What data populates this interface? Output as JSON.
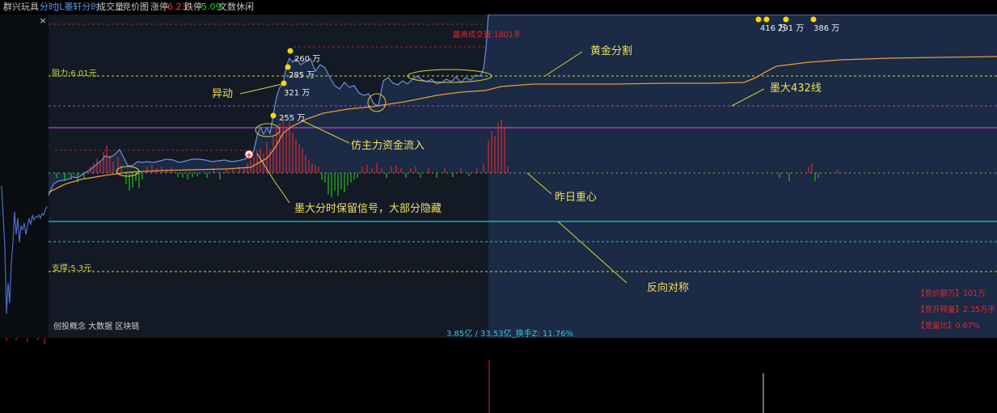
{
  "header": {
    "stock_name": "群兴玩具",
    "tab_intraday": "分时",
    "tab_custom": "JL墨轩分时",
    "btn_volume": "成交量",
    "btn_auction": "竞价图",
    "limit_up_label": "涨停",
    "limit_up_value": "6.23",
    "limit_down_label": "跌停",
    "limit_down_value": "5.09",
    "font_label": "文数休闲"
  },
  "close_glyph": "×",
  "levels": {
    "resistance_label": "阻力:6.01元",
    "support_label": "支撑:5.3元"
  },
  "annotations": {
    "yidong": "异动",
    "zhuli": "仿主力资金流入",
    "signal": "墨大分时保留信号，大部分隐藏",
    "huangjin": "黄金分割",
    "zhongxin": "昨日重心",
    "fanxiang": "反向对称",
    "mo432": "墨大432线",
    "max_volume": "最高成交量:1801手"
  },
  "volume_tags": [
    "260 万",
    "285 万",
    "321 万",
    "255 万",
    "416 万",
    "291 万",
    "386 万"
  ],
  "concepts": "创投概念 大数据 区块链",
  "turnover": "3.85亿 / 33.53亿_换手Z: 11.76%",
  "auction": {
    "amount": "【竞价额万】101万",
    "volume": "【竞开释量】2.35万手",
    "ratio": "【竞量比】0.67%"
  },
  "colors": {
    "price_line": "#6f8fd6",
    "avg_line": "#e89a3a",
    "area_fill": "#1b2a45",
    "up_bar": "#e0282c",
    "down_bar": "#1fc21f",
    "resistance": "#d7d23a",
    "magenta_line": "#d23ad2",
    "cyan_line": "#1ecbd2",
    "annotation": "#f0e060",
    "marker": "#ffd600"
  }
}
